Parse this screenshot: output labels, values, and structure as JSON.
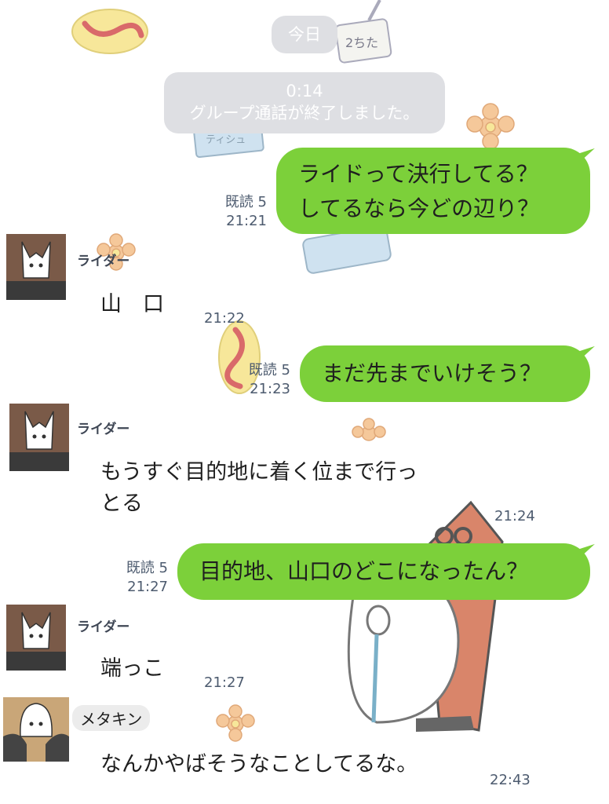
{
  "date_separator": "今日",
  "call_event": {
    "duration": "0:14",
    "text": "グループ通話が終了しました。"
  },
  "messages": [
    {
      "direction": "out",
      "text_lines": [
        "ライドって決行してる？",
        "してるなら今どの辺り？"
      ],
      "read": "既読 5",
      "time": "21:21"
    },
    {
      "direction": "in",
      "sender": "ライダー",
      "text": "山　口",
      "time": "21:22"
    },
    {
      "direction": "out",
      "text_lines": [
        "まだ先までいけそう？"
      ],
      "read": "既読 5",
      "time": "21:23"
    },
    {
      "direction": "in",
      "sender": "ライダー",
      "text_lines": [
        "もうすぐ目的地に着く位まで行っ",
        "とる"
      ],
      "time": "21:24"
    },
    {
      "direction": "out",
      "text_lines": [
        "目的地、山口のどこになったん？"
      ],
      "read": "既読 5",
      "time": "21:27"
    },
    {
      "direction": "in",
      "sender": "ライダー",
      "text": "端っこ",
      "time": "21:27"
    },
    {
      "direction": "in",
      "sender": "メタキン",
      "text": "なんかやばそうなことしてるな。",
      "time": "22:43"
    }
  ],
  "decor": {
    "tissue_label": "ティシュ",
    "card_label": "2ちた"
  },
  "colors": {
    "outgoing_bubble": "#7cd03a",
    "system_pill": "#dedfe3",
    "meta_text": "#4d5b6f"
  }
}
